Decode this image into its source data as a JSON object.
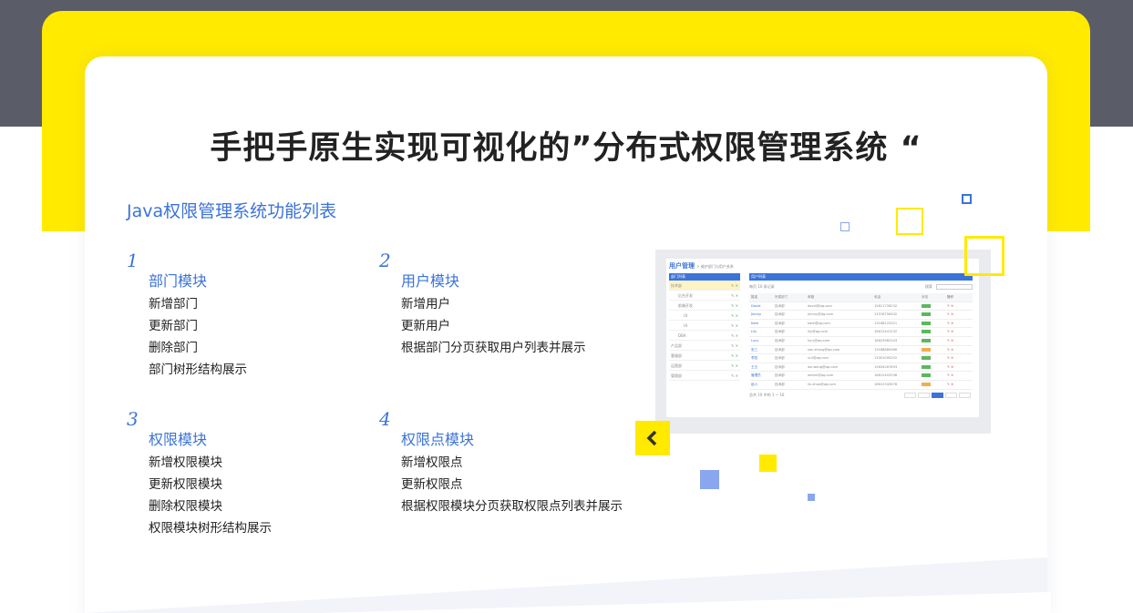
{
  "page": {
    "title": "手把手原生实现可视化的”分布式权限管理系统 “",
    "subtitle": "Java权限管理系统功能列表"
  },
  "features": [
    {
      "num": "1",
      "name": "部门模块",
      "items": [
        "新增部门",
        "更新部门",
        "删除部门",
        "部门树形结构展示"
      ]
    },
    {
      "num": "2",
      "name": "用户模块",
      "items": [
        "新增用户",
        "更新用户",
        "根据部门分页获取用户列表并展示"
      ]
    },
    {
      "num": "3",
      "name": "权限模块",
      "items": [
        "新增权限模块",
        "更新权限模块",
        "删除权限模块",
        "权限模块树形结构展示"
      ]
    },
    {
      "num": "4",
      "name": "权限点模块",
      "items": [
        "新增权限点",
        "更新权限点",
        "根据权限模块分页获取权限点列表并展示"
      ]
    }
  ],
  "mockup": {
    "title": "用户管理",
    "breadcrumb": "> 维护部门与用户关系",
    "dept_panel_title": "部门列表",
    "user_panel_title": "用户列表",
    "tree_items": [
      "技术部",
      "后台开发",
      "前端开发",
      "UI",
      "UI",
      "DBA",
      "产品部",
      "客服部",
      "运营部",
      "管理部"
    ],
    "toolbar_text": "每页  10  条记录",
    "search_label": "搜索",
    "table_headers": [
      "姓名",
      "所属部门",
      "邮箱",
      "电话",
      "状态",
      "操作"
    ],
    "rows": [
      [
        "David",
        "技术部",
        "david@qq.com",
        "15811728232",
        "on"
      ],
      [
        "Jimmy",
        "技术部",
        "jimmy@qq.com",
        "13376756342",
        "on"
      ],
      [
        "Kate",
        "技术部",
        "kate@qq.com",
        "13188123321",
        "on"
      ],
      [
        "Lily",
        "技术部",
        "lily@qq.com",
        "18612441232",
        "on"
      ],
      [
        "Lucy",
        "技术部",
        "lucy@qq.com",
        "18623982343",
        "on"
      ],
      [
        "张三",
        "技术部",
        "san.zhang@qq.com",
        "13188889466",
        "off"
      ],
      [
        "李四",
        "技术部",
        "si.li@qq.com",
        "13301095252",
        "on"
      ],
      [
        "王五",
        "技术部",
        "wu.wang@qq.com",
        "15634267893",
        "on"
      ],
      [
        "管理员",
        "技术部",
        "admin@qq.com",
        "18612403296",
        "on"
      ],
      [
        "赵六",
        "技术部",
        "liu.zhao@qq.com",
        "18612345678",
        "off"
      ]
    ],
    "footer_text": "总共 10 中的 1 ~ 10",
    "pager": [
      "首页",
      "前一页",
      "第1页",
      "后一页",
      "尾页"
    ]
  },
  "colors": {
    "accent_blue": "#3b73d9",
    "brand_yellow": "#ffea00",
    "dark_band": "#5a5d67"
  },
  "icons": {
    "prev": "chevron-left-icon"
  }
}
